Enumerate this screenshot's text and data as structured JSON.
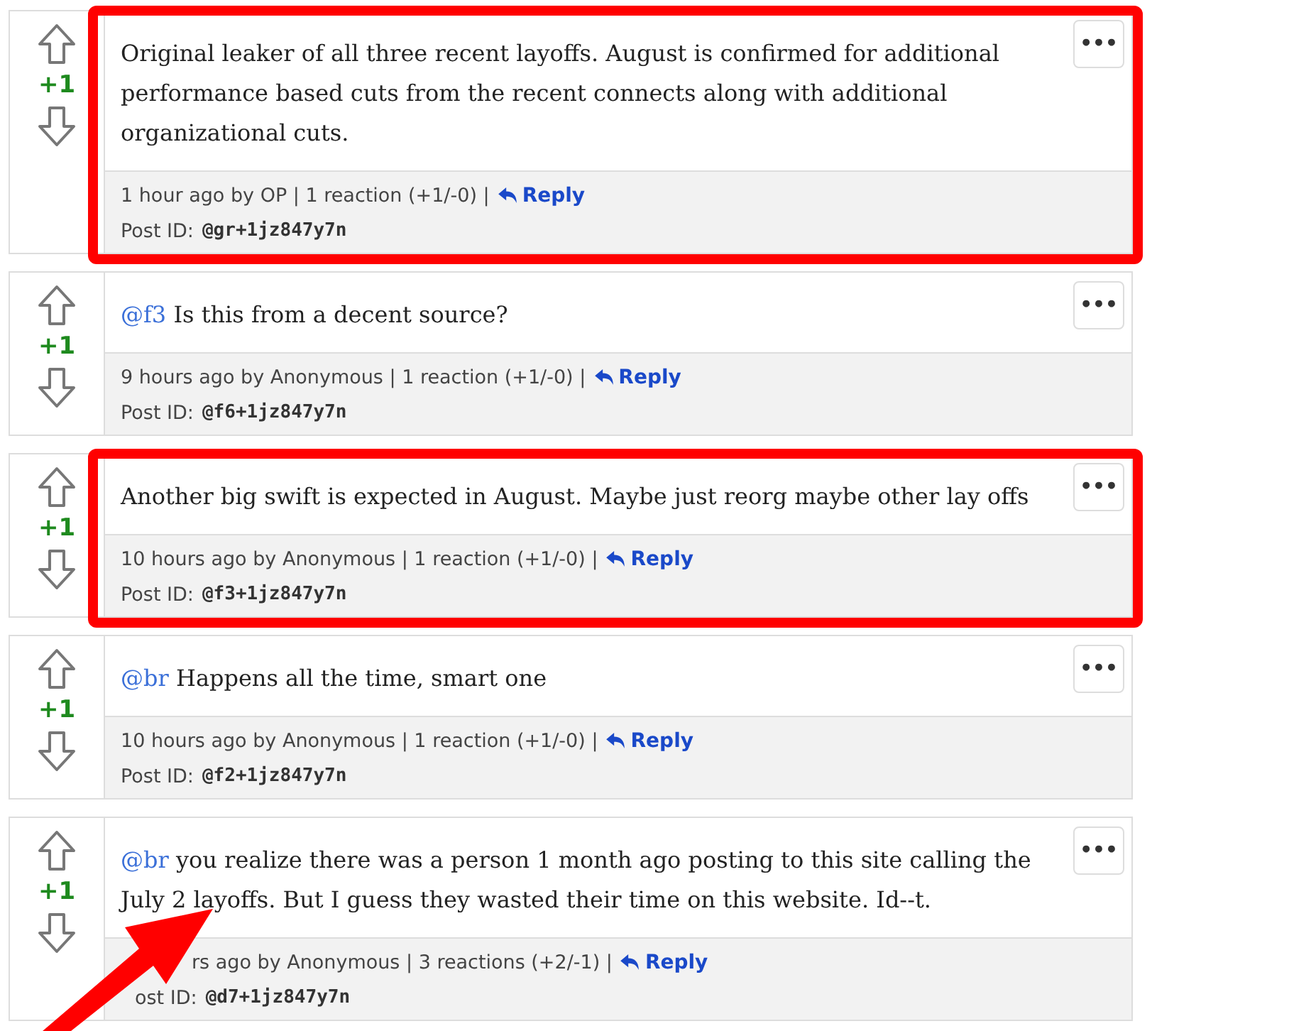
{
  "posts": [
    {
      "score": "+1",
      "body": "Original leaker of all three recent layoffs. August is confirmed for additional performance based cuts from the recent connects along with additional organizational cuts.",
      "meta": "1 hour ago by OP | 1 reaction (+1/-0) |",
      "reply": "Reply",
      "post_id_label": "Post ID:",
      "post_id": "@gr+1jz847y7n",
      "menu": "•••",
      "highlighted": true
    },
    {
      "score": "+1",
      "mention": "@f3",
      "body": "Is this from a decent source?",
      "meta": "9 hours ago by Anonymous | 1 reaction (+1/-0) |",
      "reply": "Reply",
      "post_id_label": "Post ID:",
      "post_id": "@f6+1jz847y7n",
      "menu": "•••",
      "highlighted": false
    },
    {
      "score": "+1",
      "body": "Another big swift is expected in August. Maybe just reorg maybe other lay offs",
      "meta": "10 hours ago by Anonymous | 1 reaction (+1/-0) |",
      "reply": "Reply",
      "post_id_label": "Post ID:",
      "post_id": "@f3+1jz847y7n",
      "menu": "•••",
      "highlighted": true
    },
    {
      "score": "+1",
      "mention": "@br",
      "body": "Happens all the time, smart one",
      "meta": "10 hours ago by Anonymous | 1 reaction (+1/-0) |",
      "reply": "Reply",
      "post_id_label": "Post ID:",
      "post_id": "@f2+1jz847y7n",
      "menu": "•••",
      "highlighted": false
    },
    {
      "score": "+1",
      "mention": "@br",
      "body": "you realize there was a person 1 month ago posting to this site calling the July 2 layoffs. But I guess they wasted their time on this website. Id--t.",
      "meta": "rs ago by Anonymous | 3 reactions (+2/-1) |",
      "reply": "Reply",
      "post_id_label": "ost ID:",
      "post_id": "@d7+1jz847y7n",
      "menu": "•••",
      "highlighted": false,
      "covered_by_arrow": true
    }
  ],
  "pointer_arrow": true
}
